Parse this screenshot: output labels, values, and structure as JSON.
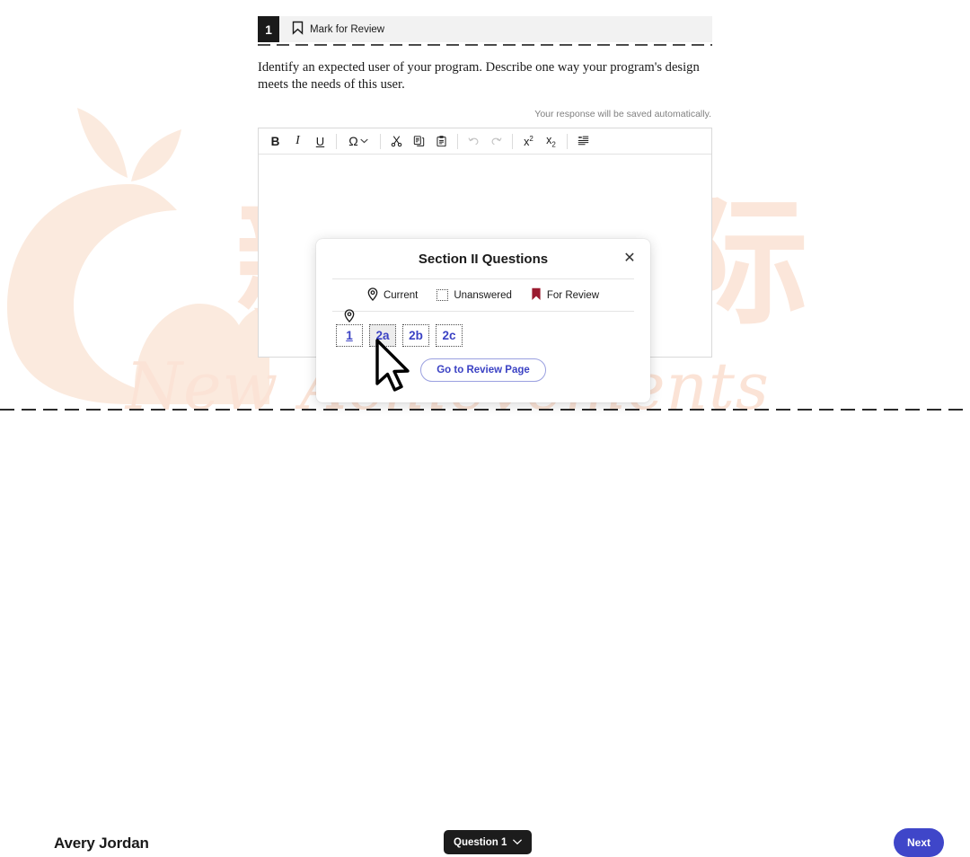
{
  "watermark": {
    "cjk_text": "新橙国际",
    "script_text": "New Achievements",
    "logo_name": "orange-logo-watermark",
    "color": "#fbe6da"
  },
  "question_header": {
    "number": "1",
    "mark_for_review_label": "Mark for Review",
    "bookmark_icon": "bookmark-icon"
  },
  "question": {
    "prompt": "Identify an expected user of your program. Describe one way your program's design meets the needs of this user."
  },
  "editor": {
    "autosave_note": "Your response will be saved automatically.",
    "body_value": "",
    "toolbar": [
      {
        "name": "bold-button",
        "label": "B",
        "icon": "bold-icon",
        "disabled": false
      },
      {
        "name": "italic-button",
        "label": "I",
        "icon": "italic-icon",
        "disabled": false
      },
      {
        "name": "underline-button",
        "label": "U",
        "icon": "underline-icon",
        "disabled": false
      },
      {
        "name": "special-character-button",
        "label": "Ω",
        "icon": "omega-icon",
        "disabled": false
      },
      {
        "name": "cut-button",
        "label": "",
        "icon": "scissors-icon",
        "disabled": false
      },
      {
        "name": "copy-button",
        "label": "",
        "icon": "copy-icon",
        "disabled": false
      },
      {
        "name": "paste-button",
        "label": "",
        "icon": "paste-icon",
        "disabled": false
      },
      {
        "name": "undo-button",
        "label": "",
        "icon": "undo-icon",
        "disabled": true
      },
      {
        "name": "redo-button",
        "label": "",
        "icon": "redo-icon",
        "disabled": true
      },
      {
        "name": "superscript-button",
        "label": "x²",
        "icon": "superscript-icon",
        "disabled": false
      },
      {
        "name": "subscript-button",
        "label": "x₂",
        "icon": "subscript-icon",
        "disabled": false
      },
      {
        "name": "indent-button",
        "label": "",
        "icon": "indent-icon",
        "disabled": false
      }
    ]
  },
  "modal": {
    "title": "Section II Questions",
    "close_label": "✕",
    "legend": [
      {
        "label": "Current",
        "icon": "location-pin-icon"
      },
      {
        "label": "Unanswered",
        "icon": "dotted-square-icon"
      },
      {
        "label": "For Review",
        "icon": "bookmark-flag-icon"
      }
    ],
    "questions": [
      {
        "label": "1",
        "current": true,
        "hovered": false,
        "unanswered": true,
        "for_review": false
      },
      {
        "label": "2a",
        "current": false,
        "hovered": true,
        "unanswered": true,
        "for_review": false
      },
      {
        "label": "2b",
        "current": false,
        "hovered": false,
        "unanswered": true,
        "for_review": false
      },
      {
        "label": "2c",
        "current": false,
        "hovered": false,
        "unanswered": true,
        "for_review": false
      }
    ],
    "go_to_review_label": "Go to Review Page"
  },
  "bottom_bar": {
    "student_name": "Avery Jordan",
    "question_selector_label": "Question 1",
    "question_selector_chevron": "chevron-down-icon",
    "next_label": "Next",
    "next_color": "#3f46c9"
  },
  "cursor": {
    "icon": "mouse-pointer-arrow"
  }
}
